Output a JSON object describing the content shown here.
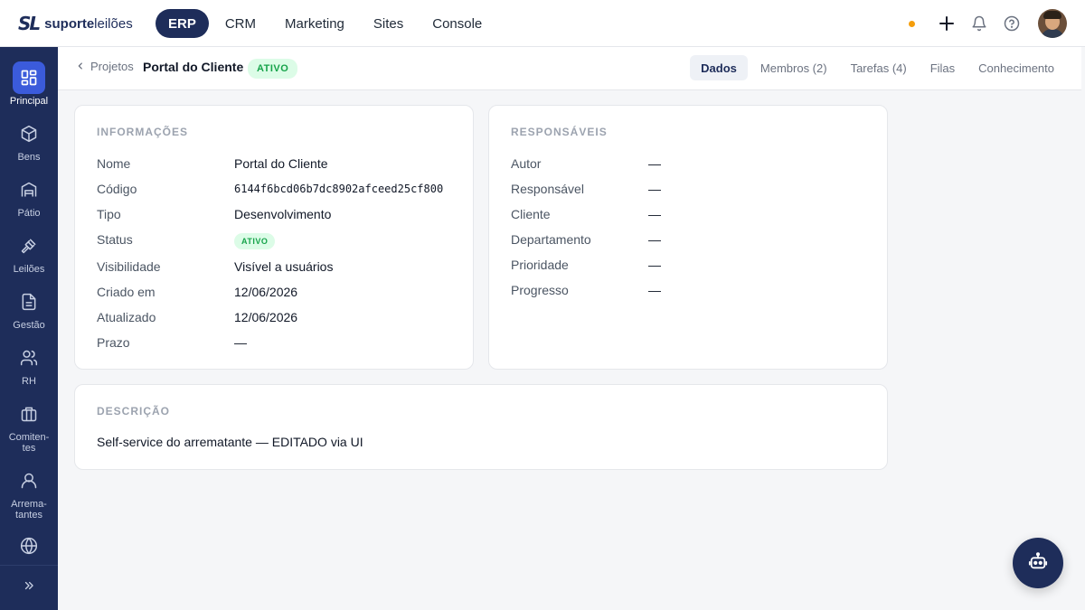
{
  "brand": {
    "mark": "SL",
    "name_bold": "suporte",
    "name_light": "leilões"
  },
  "topnav": [
    {
      "label": "ERP",
      "active": true
    },
    {
      "label": "CRM",
      "active": false
    },
    {
      "label": "Marketing",
      "active": false
    },
    {
      "label": "Sites",
      "active": false
    },
    {
      "label": "Console",
      "active": false
    }
  ],
  "top_icons": [
    "status-dot",
    "plus-icon",
    "bell-icon",
    "help-icon",
    "avatar"
  ],
  "sidebar": {
    "items": [
      {
        "label": "Principal",
        "icon": "grid-icon",
        "active": true
      },
      {
        "label": "Bens",
        "icon": "box-icon"
      },
      {
        "label": "Pátio",
        "icon": "warehouse-icon"
      },
      {
        "label": "Leilões",
        "icon": "gavel-icon"
      },
      {
        "label": "Gestão",
        "icon": "document-icon"
      },
      {
        "label": "RH",
        "icon": "people-icon"
      },
      {
        "label": "Comiten-tes",
        "icon": "briefcase-icon"
      },
      {
        "label": "Arrema-tantes",
        "icon": "person-icon"
      },
      {
        "label": "",
        "icon": "globe-icon"
      }
    ],
    "collapse_icon": "chevrons-right-icon"
  },
  "subheader": {
    "breadcrumb": "Projetos",
    "title": "Portal do Cliente",
    "status": "ATIVO",
    "tabs": [
      {
        "label": "Dados",
        "active": true
      },
      {
        "label": "Membros (2)"
      },
      {
        "label": "Tarefas (4)"
      },
      {
        "label": "Filas"
      },
      {
        "label": "Conhecimento"
      }
    ]
  },
  "info": {
    "title": "INFORMAÇÕES",
    "nome_label": "Nome",
    "nome": "Portal do Cliente",
    "codigo_label": "Código",
    "codigo": "6144f6bcd06b7dc8902afceed25cf800",
    "tipo_label": "Tipo",
    "tipo": "Desenvolvimento",
    "status_label": "Status",
    "status": "ATIVO",
    "visibilidade_label": "Visibilidade",
    "visibilidade": "Visível a usuários",
    "criado_label": "Criado em",
    "criado": "12/06/2026",
    "atualizado_label": "Atualizado",
    "atualizado": "12/06/2026",
    "prazo_label": "Prazo",
    "prazo": "—"
  },
  "responsaveis": {
    "title": "RESPONSÁVEIS",
    "rows": [
      {
        "label": "Autor",
        "value": "—"
      },
      {
        "label": "Responsável",
        "value": "—"
      },
      {
        "label": "Cliente",
        "value": "—"
      },
      {
        "label": "Departamento",
        "value": "—"
      },
      {
        "label": "Prioridade",
        "value": "—"
      },
      {
        "label": "Progresso",
        "value": "—"
      }
    ]
  },
  "descricao": {
    "title": "DESCRIÇÃO",
    "text": "Self-service do arrematante — EDITADO via UI"
  },
  "colors": {
    "navy": "#1e2d5a",
    "accent": "#3b5bdb",
    "status_green": "#16a34a",
    "notify_dot": "#f59e0b"
  },
  "fab": {
    "icon": "robot-icon"
  }
}
